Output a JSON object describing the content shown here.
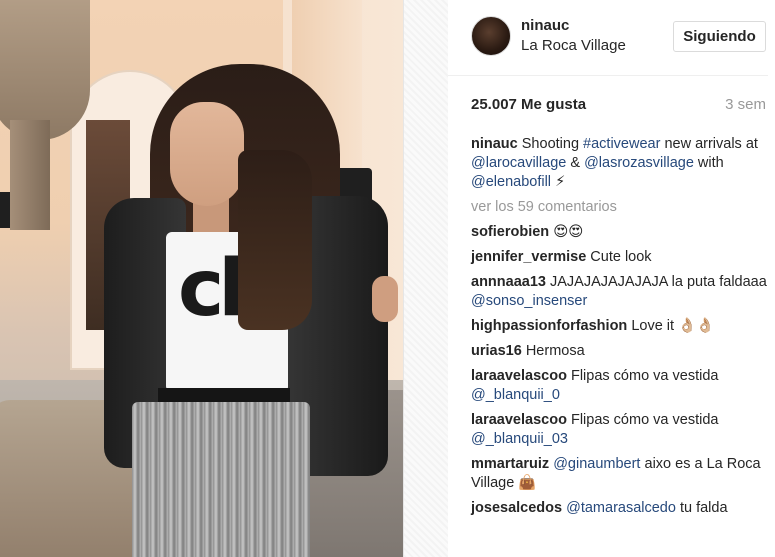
{
  "post": {
    "username": "ninauc",
    "location": "La Roca Village",
    "follow_label": "Siguiendo",
    "likes": "25.007 Me gusta",
    "time_ago": "3 sem",
    "caption": {
      "user": "ninauc",
      "t1": "Shooting",
      "hashtag": "#activewear",
      "t2": "new arrivals at",
      "mention1": "@larocavillage",
      "t3": "&",
      "mention2": "@lasrozasvillage",
      "t4": "with",
      "mention3": "@elenabofill",
      "emoji": "⚡"
    },
    "more_comments": "ver los 59 comentarios"
  },
  "comments": [
    {
      "user": "sofierobien",
      "text": "",
      "emoji": "😍😍"
    },
    {
      "user": "jennifer_vermise",
      "text": "Cute look"
    },
    {
      "user": "annnaaa13",
      "text": "JAJAJAJAJAJAJA la puta faldaaa",
      "mention": "@sonso_insenser"
    },
    {
      "user": "highpassionforfashion",
      "text": "Love it",
      "emoji": "👌🏼👌🏼"
    },
    {
      "user": "urias16",
      "text": "Hermosa"
    },
    {
      "user": "laraavelascoo",
      "text": "Flipas cómo va vestida",
      "mention": "@_blanquii_0"
    },
    {
      "user": "laraavelascoo",
      "text": "Flipas cómo va vestida",
      "mention": "@_blanquii_03"
    },
    {
      "user": "mmartaruiz",
      "mention": "@ginaumbert",
      "text": "aixo es a La Roca Village",
      "emoji": "👜"
    },
    {
      "user": "josesalcedos",
      "mention": "@tamarasalcedo",
      "text": "tu falda"
    }
  ],
  "photo": {
    "shirt_logo": "ck",
    "icon": "fashion-photo"
  }
}
